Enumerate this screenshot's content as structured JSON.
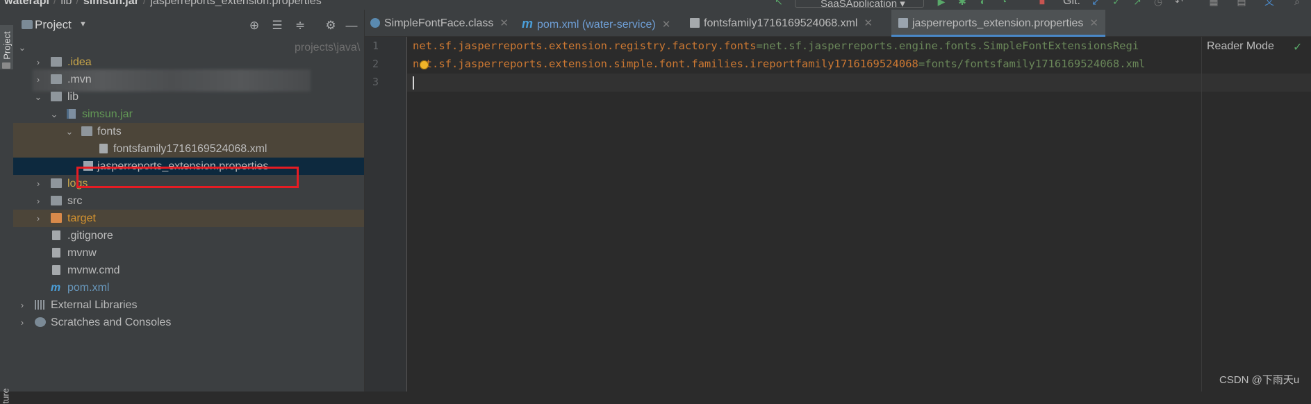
{
  "breadcrumb": {
    "items": [
      "waterapi",
      "lib",
      "simsun.jar",
      "jasperreports_extension.properties"
    ]
  },
  "toolbar": {
    "run_config": "SaaSApplication",
    "git_label": "Git:"
  },
  "left_strip": {
    "project_tab": "Project",
    "structure_tab": "ture"
  },
  "project_panel": {
    "title": "Project",
    "root_path_suffix": "projects\\java\\",
    "tree": [
      {
        "label": ".idea",
        "style": "yellow"
      },
      {
        "label": ".mvn",
        "style": "normal"
      },
      {
        "label": "lib",
        "style": "normal"
      },
      {
        "label": "simsun.jar",
        "style": "green"
      },
      {
        "label": "fonts",
        "style": "normal"
      },
      {
        "label": "fontsfamily1716169524068.xml",
        "style": "normal"
      },
      {
        "label": "jasperreports_extension.properties",
        "style": "normal"
      },
      {
        "label": "logs",
        "style": "yellow"
      },
      {
        "label": "src",
        "style": "normal"
      },
      {
        "label": "target",
        "style": "orange"
      },
      {
        "label": ".gitignore",
        "style": "normal"
      },
      {
        "label": "mvnw",
        "style": "normal"
      },
      {
        "label": "mvnw.cmd",
        "style": "normal"
      },
      {
        "label": "pom.xml",
        "style": "blue"
      },
      {
        "label": "External Libraries",
        "style": "normal"
      },
      {
        "label": "Scratches and Consoles",
        "style": "normal"
      }
    ]
  },
  "editor_tabs": [
    {
      "label": "SimpleFontFace.class",
      "active": false
    },
    {
      "label": "pom.xml (water-service)",
      "active": false
    },
    {
      "label": "fontsfamily1716169524068.xml",
      "active": false
    },
    {
      "label": "jasperreports_extension.properties",
      "active": true
    }
  ],
  "editor": {
    "line_numbers": [
      "1",
      "2",
      "3"
    ],
    "lines": [
      {
        "key": "net.sf.jasperreports.extension.registry.factory.fonts",
        "eq": "=",
        "value": "net.sf.jasperreports.engine.fonts.SimpleFontExtensionsRegi"
      },
      {
        "key": "net.sf.jasperreports.extension.simple.font.families.ireportfamily1716169524068",
        "eq": "=",
        "value": "fonts/fontsfamily1716169524068.xml"
      },
      {
        "key": "",
        "eq": "",
        "value": ""
      }
    ],
    "reader_mode": "Reader Mode"
  },
  "watermark": "CSDN @下雨天u",
  "colors": {
    "accent": "#4a88c7",
    "highlight_box": "#e51c23",
    "property_key": "#cc7832",
    "property_value": "#6a8759"
  }
}
